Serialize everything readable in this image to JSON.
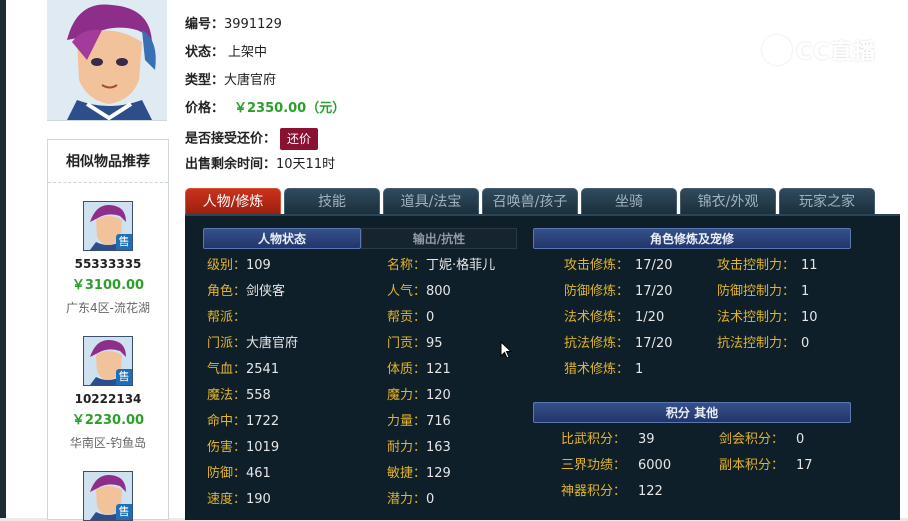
{
  "item": {
    "id_label": "编号：",
    "id_value": "3991129",
    "status_label": "状态：",
    "status_value": "上架中",
    "type_label": "类型：",
    "type_value": "大唐官府",
    "price_label": "价格：",
    "price_value": "￥2350.00（元）",
    "bargain_label": "是否接受还价：",
    "bargain_button": "还价",
    "remaining_label": "出售剩余时间：",
    "remaining_value": "10天11时"
  },
  "watermark": {
    "text": "CC直播"
  },
  "recommend": {
    "title": "相似物品推荐",
    "sold_badge": "售",
    "items": [
      {
        "id": "55333335",
        "price": "￥3100.00",
        "server": "广东4区-流花湖"
      },
      {
        "id": "10222134",
        "price": "￥2230.00",
        "server": "华南区-钓鱼岛"
      },
      {
        "id": "",
        "price": "",
        "server": ""
      }
    ]
  },
  "tabs": [
    "人物/修炼",
    "技能",
    "道具/法宝",
    "召唤兽/孩子",
    "坐骑",
    "锦衣/外观",
    "玩家之家"
  ],
  "sections": {
    "char_status": "人物状态",
    "output_resist": "输出/抗性",
    "cultivation": "角色修炼及宠修",
    "points_other": "积分 其他"
  },
  "stats_left": [
    {
      "label": "级别：",
      "value": "109"
    },
    {
      "label": "角色：",
      "value": "剑侠客"
    },
    {
      "label": "帮派：",
      "value": ""
    },
    {
      "label": "门派：",
      "value": "大唐官府"
    },
    {
      "label": "气血：",
      "value": "2541"
    },
    {
      "label": "魔法：",
      "value": "558"
    },
    {
      "label": "命中：",
      "value": "1722"
    },
    {
      "label": "伤害：",
      "value": "1019"
    },
    {
      "label": "防御：",
      "value": "461"
    },
    {
      "label": "速度：",
      "value": "190"
    }
  ],
  "stats_mid": [
    {
      "label": "名称：",
      "value": "丁妮·格菲儿"
    },
    {
      "label": "人气：",
      "value": "800"
    },
    {
      "label": "帮贡：",
      "value": "0"
    },
    {
      "label": "门贡：",
      "value": "95"
    },
    {
      "label": "体质：",
      "value": "121"
    },
    {
      "label": "魔力：",
      "value": "120"
    },
    {
      "label": "力量：",
      "value": "716"
    },
    {
      "label": "耐力：",
      "value": "163"
    },
    {
      "label": "敏捷：",
      "value": "129"
    },
    {
      "label": "潜力：",
      "value": "0"
    }
  ],
  "cultivation_left": [
    {
      "label": "攻击修炼：",
      "value": "17/20"
    },
    {
      "label": "防御修炼：",
      "value": "17/20"
    },
    {
      "label": "法术修炼：",
      "value": "1/20"
    },
    {
      "label": "抗法修炼：",
      "value": "17/20"
    },
    {
      "label": "猎术修炼：",
      "value": "1"
    }
  ],
  "cultivation_right": [
    {
      "label": "攻击控制力：",
      "value": "11"
    },
    {
      "label": "防御控制力：",
      "value": "1"
    },
    {
      "label": "法术控制力：",
      "value": "10"
    },
    {
      "label": "抗法控制力：",
      "value": "0"
    }
  ],
  "points_left": [
    {
      "label": "比武积分：",
      "value": "39"
    },
    {
      "label": "三界功绩：",
      "value": "6000"
    },
    {
      "label": "神器积分：",
      "value": "122"
    }
  ],
  "points_right": [
    {
      "label": "剑会积分：",
      "value": "0"
    },
    {
      "label": "副本积分：",
      "value": "17"
    }
  ]
}
